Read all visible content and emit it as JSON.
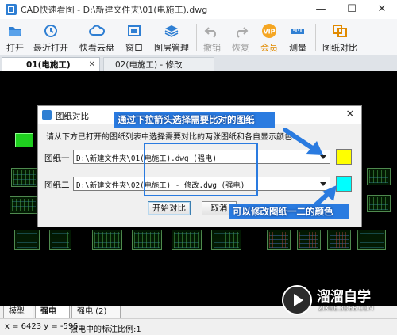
{
  "window": {
    "title": "CAD快速看图 - D:\\新建文件夹\\01(电施工).dwg",
    "controls": [
      "—",
      "☐",
      "✕"
    ]
  },
  "toolbar": {
    "items": [
      {
        "label": "打开",
        "icon": "folder-open-icon",
        "enabled": true
      },
      {
        "label": "最近打开",
        "icon": "recent-clock-icon",
        "enabled": true
      },
      {
        "label": "快看云盘",
        "icon": "cloud-icon",
        "enabled": true
      },
      {
        "label": "窗口",
        "icon": "window-icon",
        "enabled": true
      },
      {
        "label": "图层管理",
        "icon": "layers-icon",
        "enabled": true
      },
      {
        "label": "撤销",
        "icon": "undo-icon",
        "enabled": false
      },
      {
        "label": "恢复",
        "icon": "redo-icon",
        "enabled": false
      },
      {
        "label": "会员",
        "icon": "vip-badge-icon",
        "enabled": true
      },
      {
        "label": "测量",
        "icon": "ruler-icon",
        "enabled": true
      },
      {
        "label": "图纸对比",
        "icon": "compare-drawings-icon",
        "enabled": true
      }
    ],
    "colors": {
      "accent": "#2f7fd3",
      "vip": "#f5a623"
    }
  },
  "doc_tabs": [
    {
      "label": "01(电施工)",
      "active": true
    },
    {
      "label": "02(电施工) - 修改",
      "active": false
    }
  ],
  "dialog": {
    "title": "图纸对比",
    "instruction": "请从下方已打开的图纸列表中选择需要对比的两张图纸和各自显示颜色",
    "rows": [
      {
        "label": "图纸一",
        "value": "D:\\新建文件夹\\01(电施工).dwg (强电)",
        "color": "#ffff00"
      },
      {
        "label": "图纸二",
        "value": "D:\\新建文件夹\\02(电施工) - 修改.dwg (强电)",
        "color": "#00ffff"
      }
    ],
    "start_button": "开始对比",
    "cancel_button": "取消"
  },
  "annotations": {
    "arrow_tip": "通过下拉箭头选择需要比对的图纸",
    "color_tip": "可以修改图纸一二的颜色"
  },
  "layout_tabs": [
    {
      "label": "模型",
      "active": false
    },
    {
      "label": "强电",
      "active": true
    },
    {
      "label": "强电 (2)",
      "active": false
    }
  ],
  "status": {
    "coords": "x = 6423  y = -595",
    "scale_text": "强电中的标注比例:1"
  },
  "watermark": {
    "brand": "溜溜自学",
    "url": "ZIXUE.3D66.COM"
  }
}
